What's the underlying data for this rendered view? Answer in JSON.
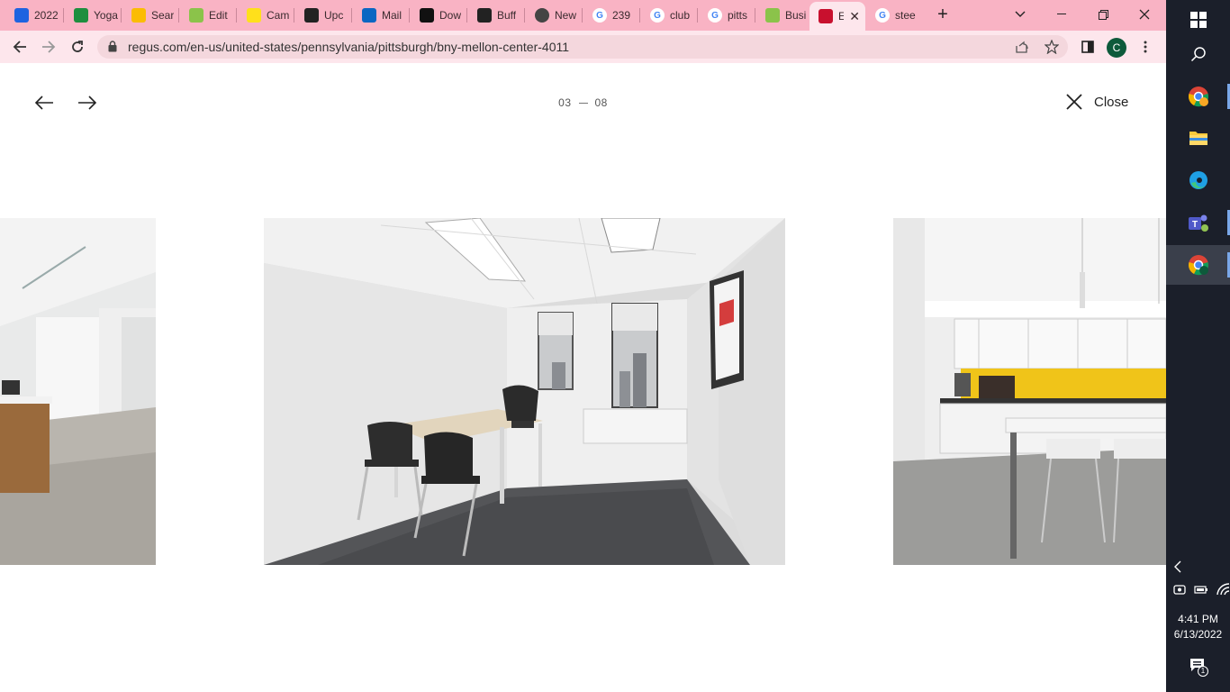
{
  "browser": {
    "tabs": [
      {
        "label": "2022",
        "icon": "dropbox-icon",
        "color": "#1e63e0"
      },
      {
        "label": "Yoga",
        "icon": "sheets-icon",
        "color": "#1e8e3e"
      },
      {
        "label": "Sear",
        "icon": "drive-icon",
        "color": "#fbbc04"
      },
      {
        "label": "Edit",
        "icon": "generic-green-icon",
        "color": "#8bc34a"
      },
      {
        "label": "Cam",
        "icon": "mailchimp-icon",
        "color": "#ffe01b"
      },
      {
        "label": "Upc",
        "icon": "trello-icon",
        "color": "#222222"
      },
      {
        "label": "Mail",
        "icon": "outlook-icon",
        "color": "#0a66c2"
      },
      {
        "label": "Dow",
        "icon": "tiktok-icon",
        "color": "#111111"
      },
      {
        "label": "Buff",
        "icon": "buffer-icon",
        "color": "#222222"
      },
      {
        "label": "New",
        "icon": "chrome-icon",
        "color": "#444444"
      },
      {
        "label": "239",
        "icon": "google-icon",
        "color": "#ffffff"
      },
      {
        "label": "club",
        "icon": "google-icon",
        "color": "#ffffff"
      },
      {
        "label": "pitts",
        "icon": "google-icon",
        "color": "#ffffff"
      },
      {
        "label": "Busi",
        "icon": "generic-green-icon",
        "color": "#8bc34a"
      },
      {
        "label": "E",
        "icon": "regus-icon",
        "color": "#c8102e",
        "active": true
      },
      {
        "label": "stee",
        "icon": "google-icon",
        "color": "#ffffff"
      }
    ],
    "url": "regus.com/en-us/united-states/pennsylvania/pittsburgh/bny-mellon-center-4011",
    "profile_initial": "C",
    "accent": "#f9b3c4"
  },
  "gallery": {
    "current": "03",
    "total": "08",
    "close_label": "Close"
  },
  "taskbar": {
    "time": "4:41 PM",
    "date": "6/13/2022",
    "notification_count": "1"
  }
}
